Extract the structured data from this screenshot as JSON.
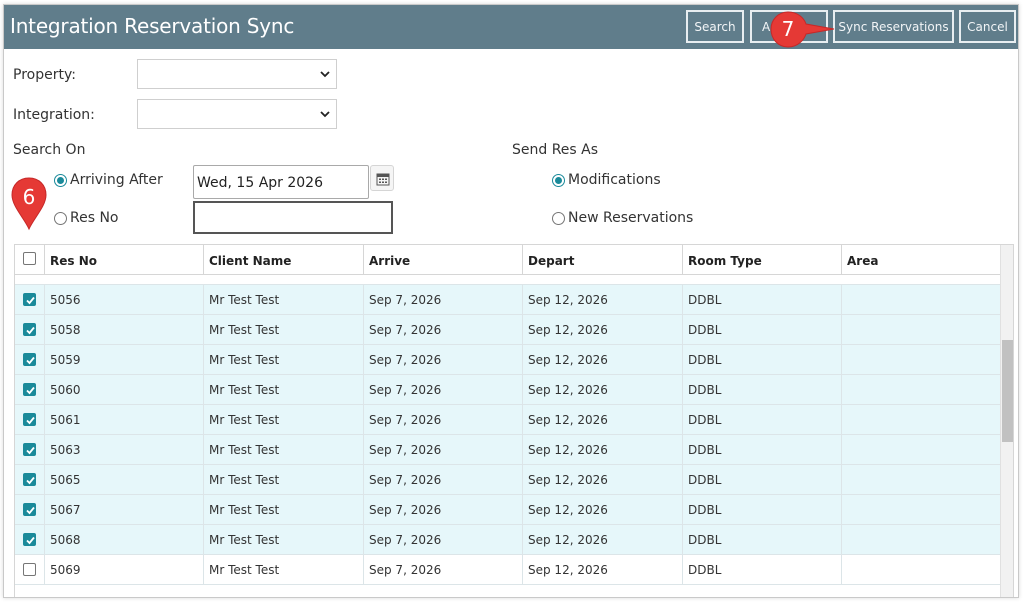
{
  "window": {
    "title": "Integration Reservation Sync",
    "buttons": {
      "search": "Search",
      "a_partial": "A",
      "sync": "Sync Reservations",
      "cancel": "Cancel"
    }
  },
  "form": {
    "property_label": "Property:",
    "property_value": "",
    "integration_label": "Integration:",
    "integration_value": "",
    "search_on_label": "Search On",
    "arriving_after_label": "Arriving After",
    "arriving_after_selected": true,
    "arriving_after_value": "Wed, 15 Apr 2026",
    "res_no_label": "Res No",
    "res_no_value": "",
    "send_res_as_label": "Send Res As",
    "modifications_label": "Modifications",
    "modifications_selected": true,
    "new_reservations_label": "New Reservations"
  },
  "table": {
    "columns": [
      "Res No",
      "Client Name",
      "Arrive",
      "Depart",
      "Room Type",
      "Area"
    ],
    "rows": [
      {
        "res_no": "5056",
        "client": "Mr Test Test",
        "arrive": "Sep 7, 2026",
        "depart": "Sep 12, 2026",
        "room_type": "DDBL",
        "area": "",
        "checked": true
      },
      {
        "res_no": "5058",
        "client": "Mr Test Test",
        "arrive": "Sep 7, 2026",
        "depart": "Sep 12, 2026",
        "room_type": "DDBL",
        "area": "",
        "checked": true
      },
      {
        "res_no": "5059",
        "client": "Mr Test Test",
        "arrive": "Sep 7, 2026",
        "depart": "Sep 12, 2026",
        "room_type": "DDBL",
        "area": "",
        "checked": true
      },
      {
        "res_no": "5060",
        "client": "Mr Test Test",
        "arrive": "Sep 7, 2026",
        "depart": "Sep 12, 2026",
        "room_type": "DDBL",
        "area": "",
        "checked": true
      },
      {
        "res_no": "5061",
        "client": "Mr Test Test",
        "arrive": "Sep 7, 2026",
        "depart": "Sep 12, 2026",
        "room_type": "DDBL",
        "area": "",
        "checked": true
      },
      {
        "res_no": "5063",
        "client": "Mr Test Test",
        "arrive": "Sep 7, 2026",
        "depart": "Sep 12, 2026",
        "room_type": "DDBL",
        "area": "",
        "checked": true
      },
      {
        "res_no": "5065",
        "client": "Mr Test Test",
        "arrive": "Sep 7, 2026",
        "depart": "Sep 12, 2026",
        "room_type": "DDBL",
        "area": "",
        "checked": true
      },
      {
        "res_no": "5067",
        "client": "Mr Test Test",
        "arrive": "Sep 7, 2026",
        "depart": "Sep 12, 2026",
        "room_type": "DDBL",
        "area": "",
        "checked": true
      },
      {
        "res_no": "5068",
        "client": "Mr Test Test",
        "arrive": "Sep 7, 2026",
        "depart": "Sep 12, 2026",
        "room_type": "DDBL",
        "area": "",
        "checked": true
      },
      {
        "res_no": "5069",
        "client": "Mr Test Test",
        "arrive": "Sep 7, 2026",
        "depart": "Sep 12, 2026",
        "room_type": "DDBL",
        "area": "",
        "checked": false
      }
    ]
  },
  "annotations": {
    "step6": "6",
    "step7": "7"
  },
  "colors": {
    "titlebar": "#607d8b",
    "selected_row": "#e6f7fa",
    "accent": "#1a8a9a",
    "callout": "#e53935"
  },
  "icons": {
    "calendar": "calendar-icon",
    "chevron": "chevron-down-icon",
    "check": "checkmark-icon"
  }
}
